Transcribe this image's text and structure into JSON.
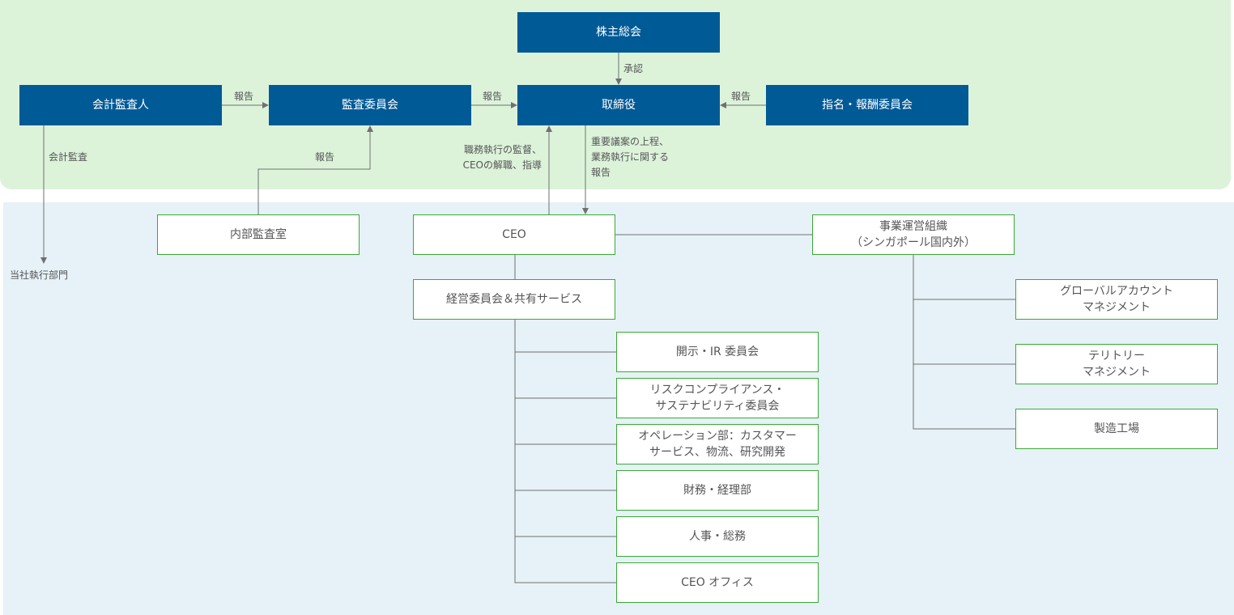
{
  "colors": {
    "navy": "#005a96",
    "top_panel": "#dcf3da",
    "bottom_panel": "#e6f2f7",
    "border": "#3aaa35",
    "line": "#707070"
  },
  "boxes": {
    "shareholders": "株主総会",
    "auditor": "会計監査人",
    "audit_committee": "監査委員会",
    "board": "取締役",
    "nomination": "指名・報酬委員会",
    "internal_audit": "内部監査室",
    "ceo": "CEO",
    "business_org": "事業運営組織\n（シンガポール国内外）",
    "management": "経営委員会＆共有サービス",
    "sub": [
      "開示・IR 委員会",
      "リスクコンプライアンス・\nサステナビリティ委員会",
      "オペレーション部：カスタマー\nサービス、物流、研究開発",
      "財務・経理部",
      "人事・総務",
      "CEO オフィス"
    ],
    "right": [
      "グローバルアカウント\nマネジメント",
      "テリトリー\nマネジメント",
      "製造工場"
    ]
  },
  "labels": {
    "approval": "承認",
    "report1": "報告",
    "report2": "報告",
    "report3": "報告",
    "report_internal": "報告",
    "accounting_audit": "会計監査",
    "executive_dept": "当社執行部門",
    "supervision": "職務執行の監督、\nCEOの解職、指導",
    "reporting": "重要議案の上程、\n業務執行に関する\n報告"
  }
}
